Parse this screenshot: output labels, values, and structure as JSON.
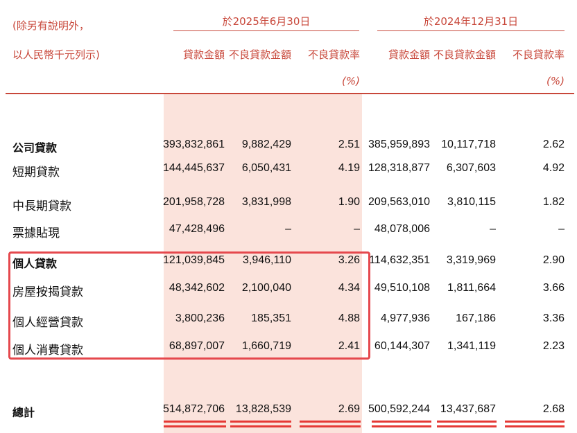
{
  "header": {
    "note_line1": "(除另有說明外，",
    "note_line2": "以人民幣千元列示)",
    "period1": "於2025年6月30日",
    "period2": "於2024年12月31日",
    "col_loan_amount": "貸款金額",
    "col_npl_amount": "不良貸款金額",
    "col_npl_ratio": "不良貸款率",
    "pct_unit": "(%)"
  },
  "rows": [
    {
      "label": "公司貸款",
      "bold": true,
      "v": [
        "393,832,861",
        "9,882,429",
        "2.51",
        "385,959,893",
        "10,117,718",
        "2.62"
      ]
    },
    {
      "label": "短期貸款",
      "bold": false,
      "v": [
        "144,445,637",
        "6,050,431",
        "4.19",
        "128,318,877",
        "6,307,603",
        "4.92"
      ]
    },
    {
      "label": "中長期貸款",
      "bold": false,
      "v": [
        "201,958,728",
        "3,831,998",
        "1.90",
        "209,563,010",
        "3,810,115",
        "1.82"
      ]
    },
    {
      "label": "票據貼現",
      "bold": false,
      "v": [
        "47,428,496",
        "–",
        "–",
        "48,078,006",
        "–",
        "–"
      ]
    },
    {
      "label": "個人貸款",
      "bold": true,
      "v": [
        "121,039,845",
        "3,946,110",
        "3.26",
        "114,632,351",
        "3,319,969",
        "2.90"
      ]
    },
    {
      "label": "房屋按揭貸款",
      "bold": false,
      "v": [
        "48,342,602",
        "2,100,040",
        "4.34",
        "49,510,108",
        "1,811,664",
        "3.66"
      ]
    },
    {
      "label": "個人經營貸款",
      "bold": false,
      "v": [
        "3,800,236",
        "185,351",
        "4.88",
        "4,977,936",
        "167,186",
        "3.36"
      ]
    },
    {
      "label": "個人消費貸款",
      "bold": false,
      "v": [
        "68,897,007",
        "1,660,719",
        "2.41",
        "60,144,307",
        "1,341,119",
        "2.23"
      ]
    }
  ],
  "total": {
    "label": "總計",
    "v": [
      "514,872,706",
      "13,828,539",
      "2.69",
      "500,592,244",
      "13,437,687",
      "2.68"
    ]
  }
}
